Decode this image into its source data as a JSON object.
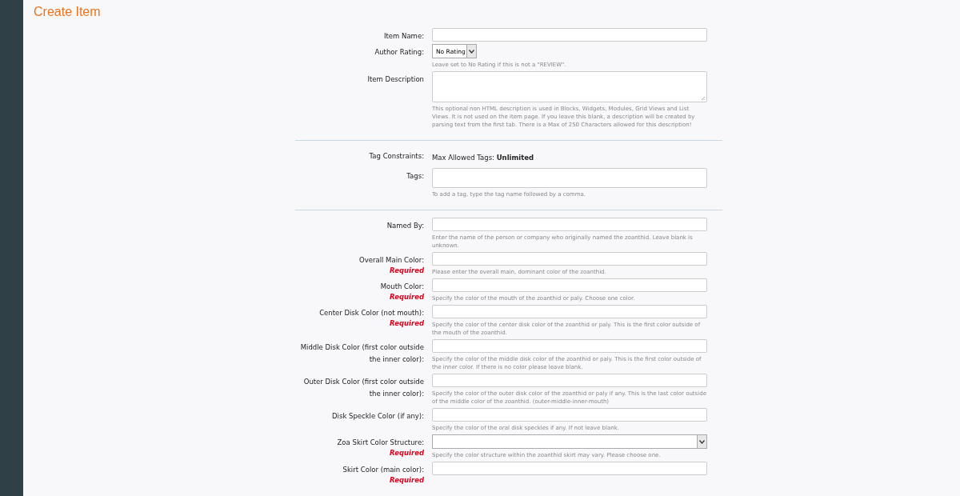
{
  "title": "Create Item",
  "sections": [
    {
      "fields": [
        {
          "kind": "text",
          "label": "Item Name:"
        },
        {
          "kind": "short_select",
          "label": "Author Rating:",
          "value": "No Rating",
          "hint": "Leave set to No Rating if this is not a \"REVIEW\"."
        },
        {
          "kind": "textarea",
          "label": "Item Description",
          "hint": "This optional non HTML description is used in Blocks, Widgets, Modules, Grid Views and List Views. It is not used on the item page. If you leave this blank, a description will be created by parsing text from the first tab. There is a Max of 250 Characters allowed for this description!"
        }
      ]
    },
    {
      "fields": [
        {
          "kind": "static",
          "label": "Tag Constraints:",
          "text": "Max Allowed Tags: **Unlimited**"
        },
        {
          "kind": "tags",
          "label": "Tags:",
          "hint": "To add a tag, type the tag name followed by a comma."
        }
      ]
    },
    {
      "fields": [
        {
          "kind": "text",
          "label": "Named By:",
          "hint": "Enter the name of the person or company who originally named the zoanthid. Leave blank is unknown."
        },
        {
          "kind": "text",
          "label": "Overall Main Color:",
          "required": "Required",
          "hint": "Please enter the overall main, dominant color of the zoanthid."
        },
        {
          "kind": "text",
          "label": "Mouth Color:",
          "required": "Required",
          "hint": "Specify the color of the mouth of the zoanthid or paly. Choose one color."
        },
        {
          "kind": "text",
          "label": "Center Disk Color (not mouth):",
          "required": "Required",
          "hint": "Specify the color of the center disk color of the zoanthid or paly. This is the first color outside of the mouth of the zoanthid."
        },
        {
          "kind": "text",
          "label": "Middle Disk Color (first color outside the inner color):",
          "hint": "Specify the color of the middle disk color of the zoanthid or paly. This is the first color outside of the inner color. If there is no color please leave blank."
        },
        {
          "kind": "text",
          "label": "Outer Disk Color (first color outside the inner color):",
          "hint": "Specify the color of the outer disk color of the zoanthid or paly if any. This is the last color outside of the middle color of the zoanthid. (outer-middle-inner-mouth)"
        },
        {
          "kind": "text",
          "label": "Disk Speckle Color (if any):",
          "hint": "Specify the color of the oral disk speckles if any. If not leave blank."
        },
        {
          "kind": "select",
          "label": "Zoa Skirt Color Structure:",
          "required": "Required",
          "hint": "Specify the color structure within the zoanthid skirt may vary. Please choose one."
        },
        {
          "kind": "text",
          "label": "Skirt Color (main color):",
          "required": "Required"
        }
      ]
    }
  ]
}
